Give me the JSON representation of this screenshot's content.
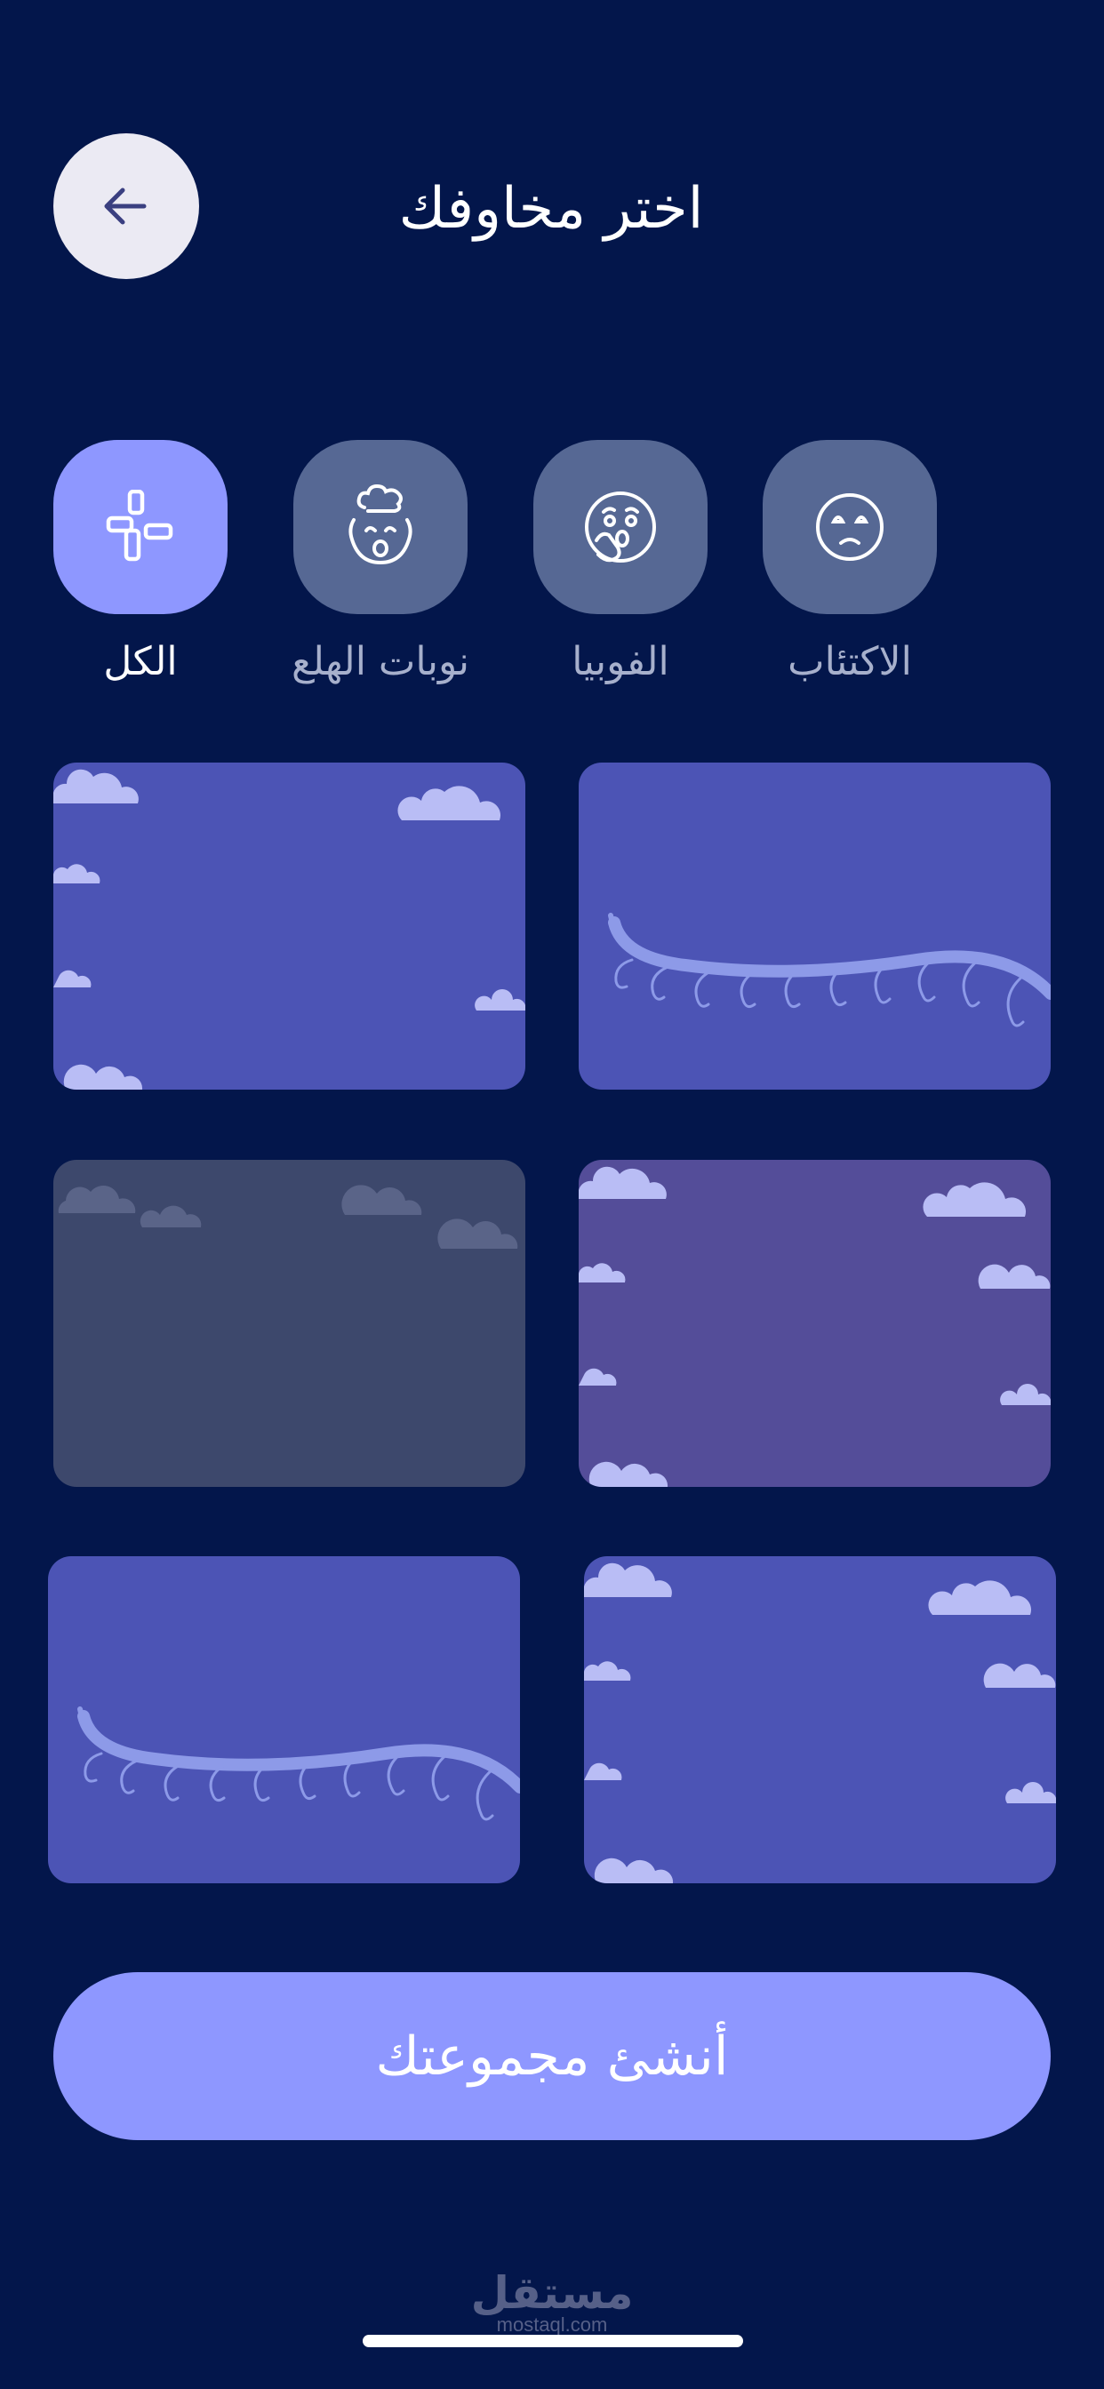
{
  "header": {
    "title": "اختر مخاوفك",
    "back_icon": "arrow-left-icon"
  },
  "categories": [
    {
      "label": "الكل",
      "icon": "grid-icon",
      "selected": true
    },
    {
      "label": "نوبات الهلع",
      "icon": "mind-blown-face-icon",
      "selected": false
    },
    {
      "label": "الفوبيا",
      "icon": "shocked-face-icon",
      "selected": false
    },
    {
      "label": "الاكتئاب",
      "icon": "sad-face-icon",
      "selected": false
    }
  ],
  "cards": [
    {
      "theme": "clouds",
      "color": "#4c54b5"
    },
    {
      "theme": "branch",
      "color": "#4c54b5"
    },
    {
      "theme": "clouds",
      "color": "#3d486c"
    },
    {
      "theme": "clouds",
      "color": "#544d99"
    },
    {
      "theme": "branch",
      "color": "#4c54b5"
    },
    {
      "theme": "clouds",
      "color": "#4c54b5"
    }
  ],
  "cta": {
    "label": "أنشئ مجموعتك"
  },
  "watermark": {
    "arabic": "مستقل",
    "latin": "mostaql.com"
  },
  "colors": {
    "background": "#03164b",
    "accent": "#8e97ff",
    "tile_inactive": "#566894",
    "label_active": "#ffffff",
    "label_inactive": "#a7b0cc"
  }
}
